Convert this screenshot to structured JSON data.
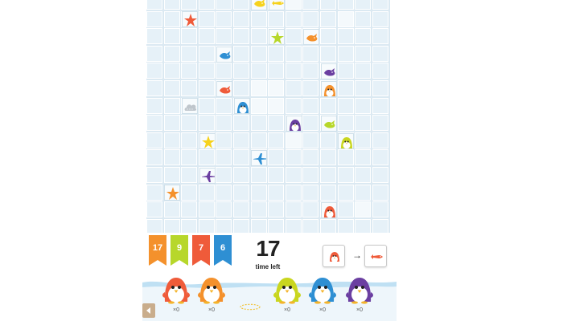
{
  "board": {
    "rows": 14,
    "cols": 14,
    "lit_cells": [
      [
        0,
        8
      ],
      [
        1,
        11
      ],
      [
        5,
        6
      ],
      [
        5,
        7
      ],
      [
        6,
        6
      ],
      [
        6,
        7
      ],
      [
        8,
        8
      ],
      [
        12,
        12
      ]
    ],
    "pieces": [
      {
        "kind": "fish",
        "color": "#f6d21c",
        "row": 0,
        "col": 7
      },
      {
        "kind": "bird",
        "color": "#f6d21c",
        "row": 0,
        "col": 6
      },
      {
        "kind": "star",
        "color": "#ef5b3a",
        "row": 1,
        "col": 2
      },
      {
        "kind": "star",
        "color": "#b7d72b",
        "row": 2,
        "col": 7
      },
      {
        "kind": "bird",
        "color": "#f4912c",
        "row": 2,
        "col": 9
      },
      {
        "kind": "bird",
        "color": "#2e8fd3",
        "row": 3,
        "col": 4
      },
      {
        "kind": "bird",
        "color": "#6b3fa1",
        "row": 4,
        "col": 10
      },
      {
        "kind": "bird",
        "color": "#ef5b3a",
        "row": 5,
        "col": 4
      },
      {
        "kind": "penguin",
        "color": "#f4912c",
        "row": 5,
        "col": 10
      },
      {
        "kind": "penguin",
        "color": "#2e8fd3",
        "row": 6,
        "col": 5
      },
      {
        "kind": "cloud",
        "color": "#bfc6cc",
        "row": 6,
        "col": 2
      },
      {
        "kind": "penguin",
        "color": "#6b3fa1",
        "row": 7,
        "col": 8
      },
      {
        "kind": "bird",
        "color": "#b7d72b",
        "row": 7,
        "col": 10
      },
      {
        "kind": "penguin",
        "color": "#c9d61f",
        "row": 8,
        "col": 11
      },
      {
        "kind": "star",
        "color": "#f6d21c",
        "row": 8,
        "col": 3
      },
      {
        "kind": "plane",
        "color": "#2e8fd3",
        "row": 9,
        "col": 6
      },
      {
        "kind": "plane",
        "color": "#6b3fa1",
        "row": 10,
        "col": 3
      },
      {
        "kind": "star",
        "color": "#f4912c",
        "row": 11,
        "col": 1
      },
      {
        "kind": "penguin",
        "color": "#ef5b3a",
        "row": 12,
        "col": 10
      }
    ]
  },
  "scores": [
    {
      "value": "17",
      "color": "#f4912c"
    },
    {
      "value": "9",
      "color": "#b7d72b"
    },
    {
      "value": "7",
      "color": "#ef5b3a"
    },
    {
      "value": "6",
      "color": "#2e8fd3"
    }
  ],
  "timer": {
    "value": "17",
    "label": "time left"
  },
  "hint": {
    "from_icon": "red-penguin-icon",
    "to_icon": "red-fish-icon",
    "arrow": "→",
    "from_color": "#ef5b3a",
    "to_color": "#ef5b3a"
  },
  "penguins": [
    {
      "color": "#ef5b3a",
      "count": "×0"
    },
    {
      "color": "#f4912c",
      "count": "×0"
    },
    {
      "color": "#c9d61f",
      "count": "×0"
    },
    {
      "color": "#2e8fd3",
      "count": "×0"
    },
    {
      "color": "#6b3fa1",
      "count": "×0"
    }
  ],
  "back_icon": "back-arrow-icon",
  "colors": {
    "board": "#dbe9f2",
    "ice": "#eaf4fa",
    "sea": "#bfe0f3"
  }
}
